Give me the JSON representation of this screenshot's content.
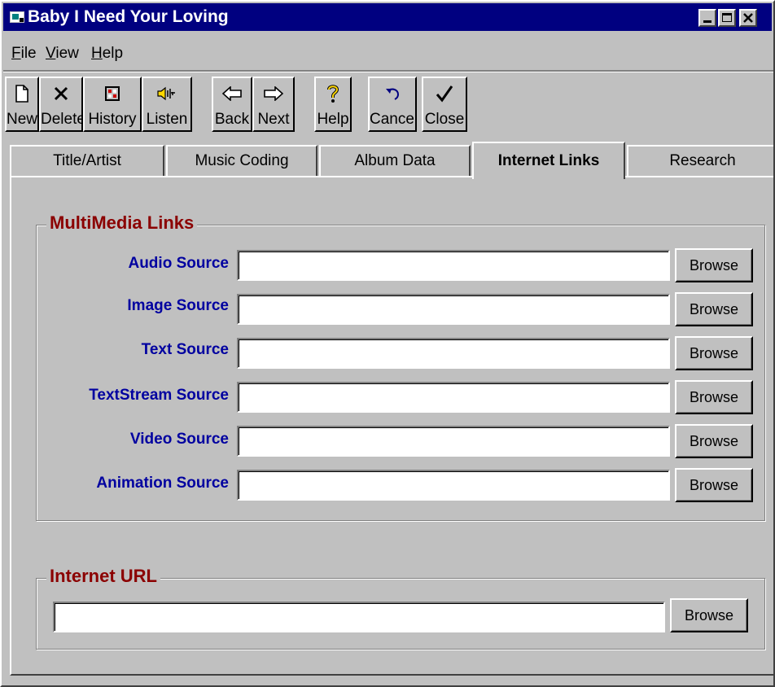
{
  "window": {
    "title": "Baby I Need Your Loving"
  },
  "menu": [
    "File",
    "View",
    "Help"
  ],
  "toolbar": [
    {
      "label": "New",
      "icon": "new-document-icon"
    },
    {
      "label": "Delete",
      "icon": "x-icon"
    },
    {
      "label": "History",
      "icon": "history-icon"
    },
    {
      "label": "Listen",
      "icon": "speaker-icon"
    },
    {
      "label": "Back",
      "icon": "left-arrow-icon"
    },
    {
      "label": "Next",
      "icon": "right-arrow-icon"
    },
    {
      "label": "Help",
      "icon": "question-icon"
    },
    {
      "label": "Cancel",
      "icon": "undo-icon"
    },
    {
      "label": "Close",
      "icon": "checkmark-icon"
    }
  ],
  "tabs": [
    "Title/Artist",
    "Music Coding",
    "Album Data",
    "Internet Links",
    "Research"
  ],
  "active_tab": "Internet Links",
  "multimedia": {
    "title": "MultiMedia Links",
    "fields": [
      {
        "label": "Audio Source",
        "value": "",
        "button": "Browse"
      },
      {
        "label": "Image Source",
        "value": "",
        "button": "Browse"
      },
      {
        "label": "Text Source",
        "value": "",
        "button": "Browse"
      },
      {
        "label": "TextStream Source",
        "value": "",
        "button": "Browse"
      },
      {
        "label": "Video Source",
        "value": "",
        "button": "Browse"
      },
      {
        "label": "Animation Source",
        "value": "",
        "button": "Browse"
      }
    ]
  },
  "internet": {
    "title": "Internet URL",
    "value": "",
    "button": "Browse"
  },
  "colors": {
    "titlebar": "#000080",
    "group_title": "#8b0000",
    "field_label": "#0000a0",
    "face": "#c0c0c0"
  }
}
